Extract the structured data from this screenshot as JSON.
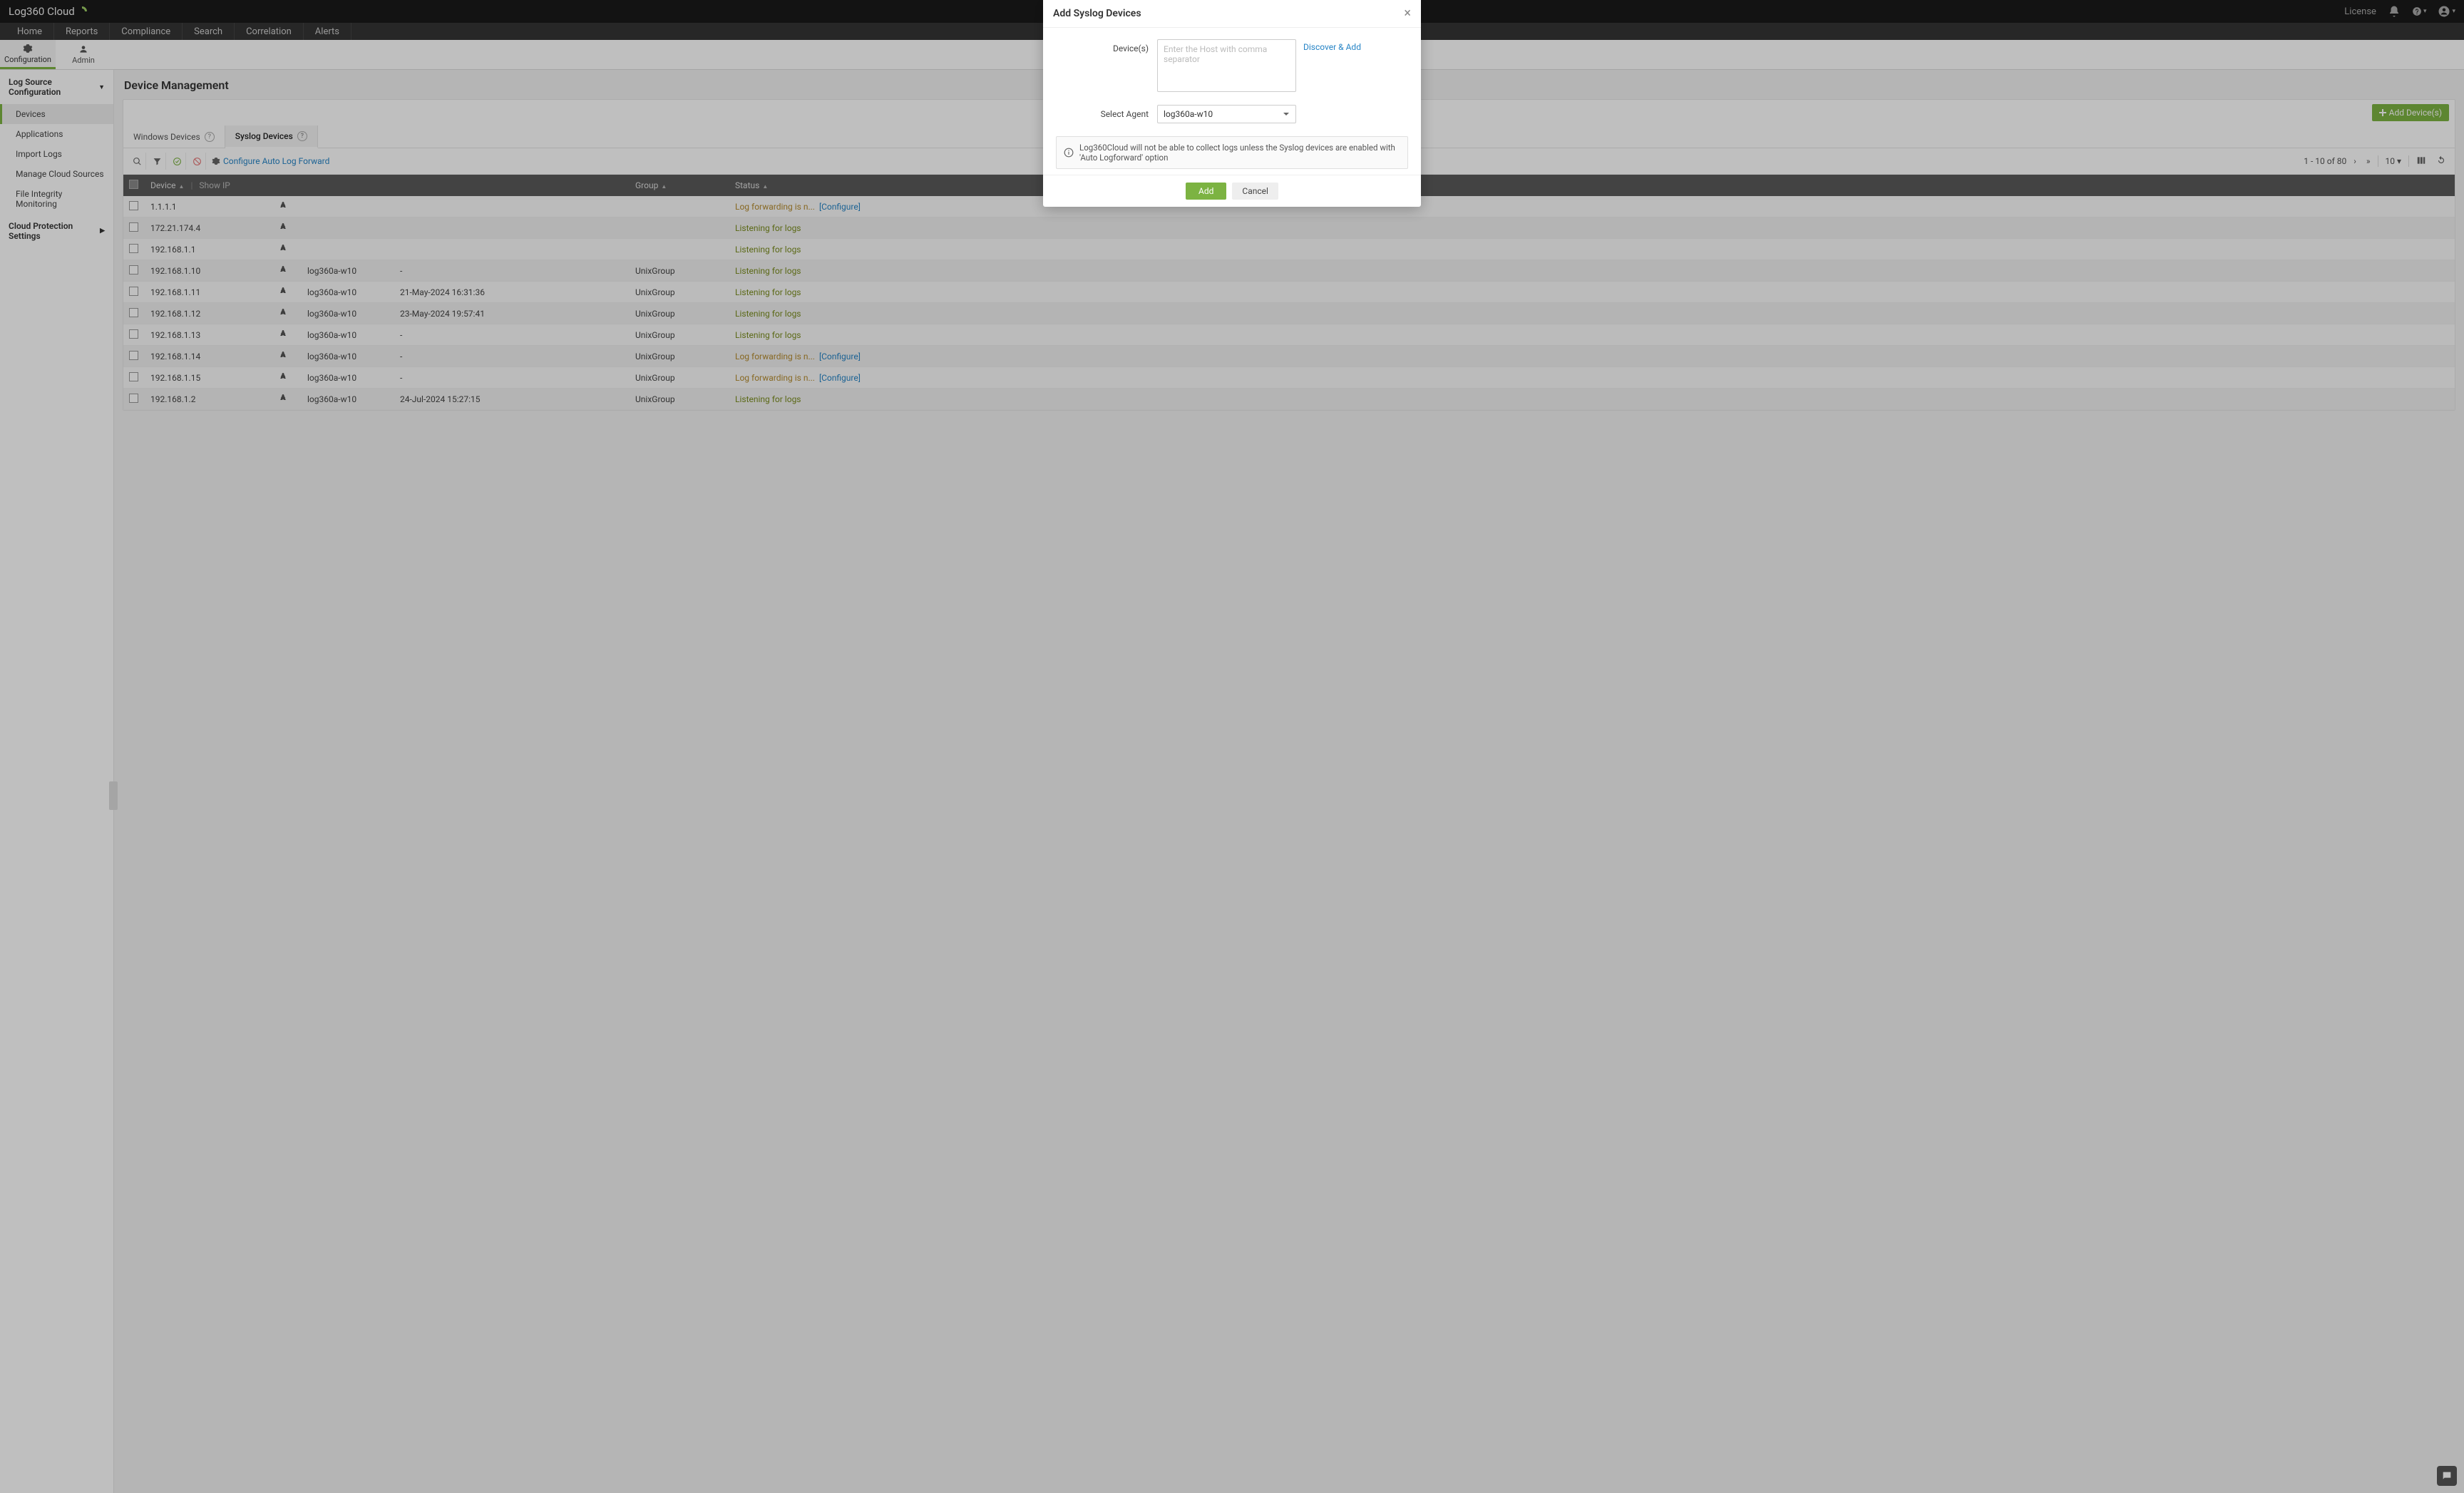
{
  "brand": {
    "name": "Log360 Cloud"
  },
  "topbar": {
    "license": "License"
  },
  "nav": {
    "items": [
      "Home",
      "Reports",
      "Compliance",
      "Search",
      "Correlation",
      "Alerts"
    ]
  },
  "subnav": {
    "config": "Configuration",
    "admin": "Admin"
  },
  "sidebar": {
    "section1": "Log Source Configuration",
    "items": [
      "Devices",
      "Applications",
      "Import Logs",
      "Manage Cloud Sources",
      "File Integrity Monitoring"
    ],
    "section2": "Cloud Protection Settings"
  },
  "page": {
    "title": "Device Management"
  },
  "tabs": {
    "win": "Windows Devices",
    "syslog": "Syslog Devices"
  },
  "toolbar": {
    "autolog": "Configure Auto Log Forward",
    "addBtn": "Add Device(s)",
    "pag": "1 - 10 of 80",
    "pageSize": "10"
  },
  "tableHead": {
    "device": "Device",
    "showip": "Show IP",
    "group": "Group",
    "status": "Status"
  },
  "status": {
    "listening": "Listening for logs",
    "notcfg": "Log forwarding is n...",
    "configure": "[Configure]"
  },
  "rows": [
    {
      "ip": "1.1.1.1",
      "agent": "",
      "time": "",
      "group": "",
      "status": "fwd"
    },
    {
      "ip": "172.21.174.4",
      "agent": "",
      "time": "",
      "group": "",
      "status": "listen"
    },
    {
      "ip": "192.168.1.1",
      "agent": "",
      "time": "",
      "group": "",
      "status": "listen"
    },
    {
      "ip": "192.168.1.10",
      "agent": "log360a-w10",
      "time": "-",
      "group": "UnixGroup",
      "status": "listen"
    },
    {
      "ip": "192.168.1.11",
      "agent": "log360a-w10",
      "time": "21-May-2024 16:31:36",
      "group": "UnixGroup",
      "status": "listen"
    },
    {
      "ip": "192.168.1.12",
      "agent": "log360a-w10",
      "time": "23-May-2024 19:57:41",
      "group": "UnixGroup",
      "status": "listen"
    },
    {
      "ip": "192.168.1.13",
      "agent": "log360a-w10",
      "time": "-",
      "group": "UnixGroup",
      "status": "listen"
    },
    {
      "ip": "192.168.1.14",
      "agent": "log360a-w10",
      "time": "-",
      "group": "UnixGroup",
      "status": "fwd"
    },
    {
      "ip": "192.168.1.15",
      "agent": "log360a-w10",
      "time": "-",
      "group": "UnixGroup",
      "status": "fwd"
    },
    {
      "ip": "192.168.1.2",
      "agent": "log360a-w10",
      "time": "24-Jul-2024 15:27:15",
      "group": "UnixGroup",
      "status": "listen"
    }
  ],
  "modal": {
    "title": "Add Syslog Devices",
    "deviceLabel": "Device(s)",
    "devicePlaceholder": "Enter the Host with comma separator",
    "discover": "Discover & Add",
    "agentLabel": "Select Agent",
    "agentValue": "log360a-w10",
    "note": "Log360Cloud will not be able to collect logs unless the Syslog devices are enabled with 'Auto Logforward' option",
    "addBtn": "Add",
    "cancelBtn": "Cancel"
  }
}
